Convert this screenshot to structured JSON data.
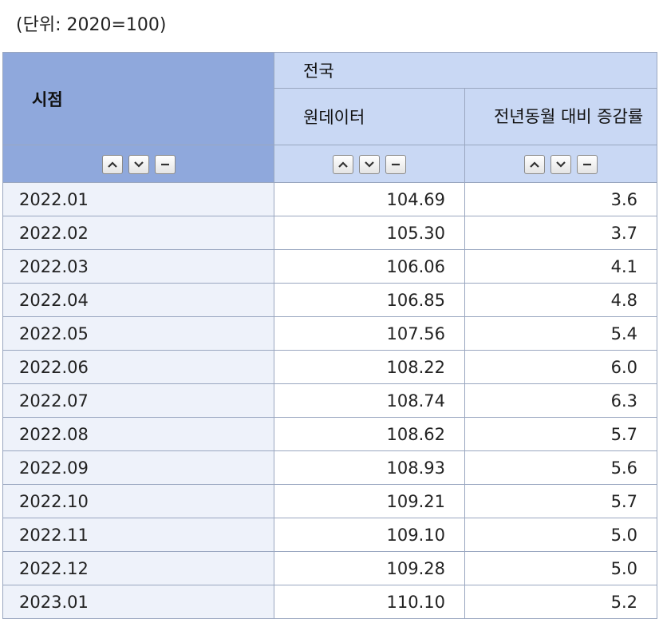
{
  "unit_label": "(단위: 2020=100)",
  "header": {
    "time_label": "시점",
    "region_label": "전국",
    "col_raw": "원데이터",
    "col_change": "전년동월 대비 증감률"
  },
  "sort_icons": [
    "sort-ascending-icon",
    "sort-descending-icon",
    "sort-clear-icon"
  ],
  "rows": [
    {
      "time": "2022.01",
      "raw": "104.69",
      "change": "3.6"
    },
    {
      "time": "2022.02",
      "raw": "105.30",
      "change": "3.7"
    },
    {
      "time": "2022.03",
      "raw": "106.06",
      "change": "4.1"
    },
    {
      "time": "2022.04",
      "raw": "106.85",
      "change": "4.8"
    },
    {
      "time": "2022.05",
      "raw": "107.56",
      "change": "5.4"
    },
    {
      "time": "2022.06",
      "raw": "108.22",
      "change": "6.0"
    },
    {
      "time": "2022.07",
      "raw": "108.74",
      "change": "6.3"
    },
    {
      "time": "2022.08",
      "raw": "108.62",
      "change": "5.7"
    },
    {
      "time": "2022.09",
      "raw": "108.93",
      "change": "5.6"
    },
    {
      "time": "2022.10",
      "raw": "109.21",
      "change": "5.7"
    },
    {
      "time": "2022.11",
      "raw": "109.10",
      "change": "5.0"
    },
    {
      "time": "2022.12",
      "raw": "109.28",
      "change": "5.0"
    },
    {
      "time": "2023.01",
      "raw": "110.10",
      "change": "5.2"
    }
  ],
  "colors": {
    "time_header_bg": "#8fa8dc",
    "col_header_bg": "#c9d8f4",
    "time_cell_bg": "#eef2fa",
    "border": "#9aa7c0"
  }
}
